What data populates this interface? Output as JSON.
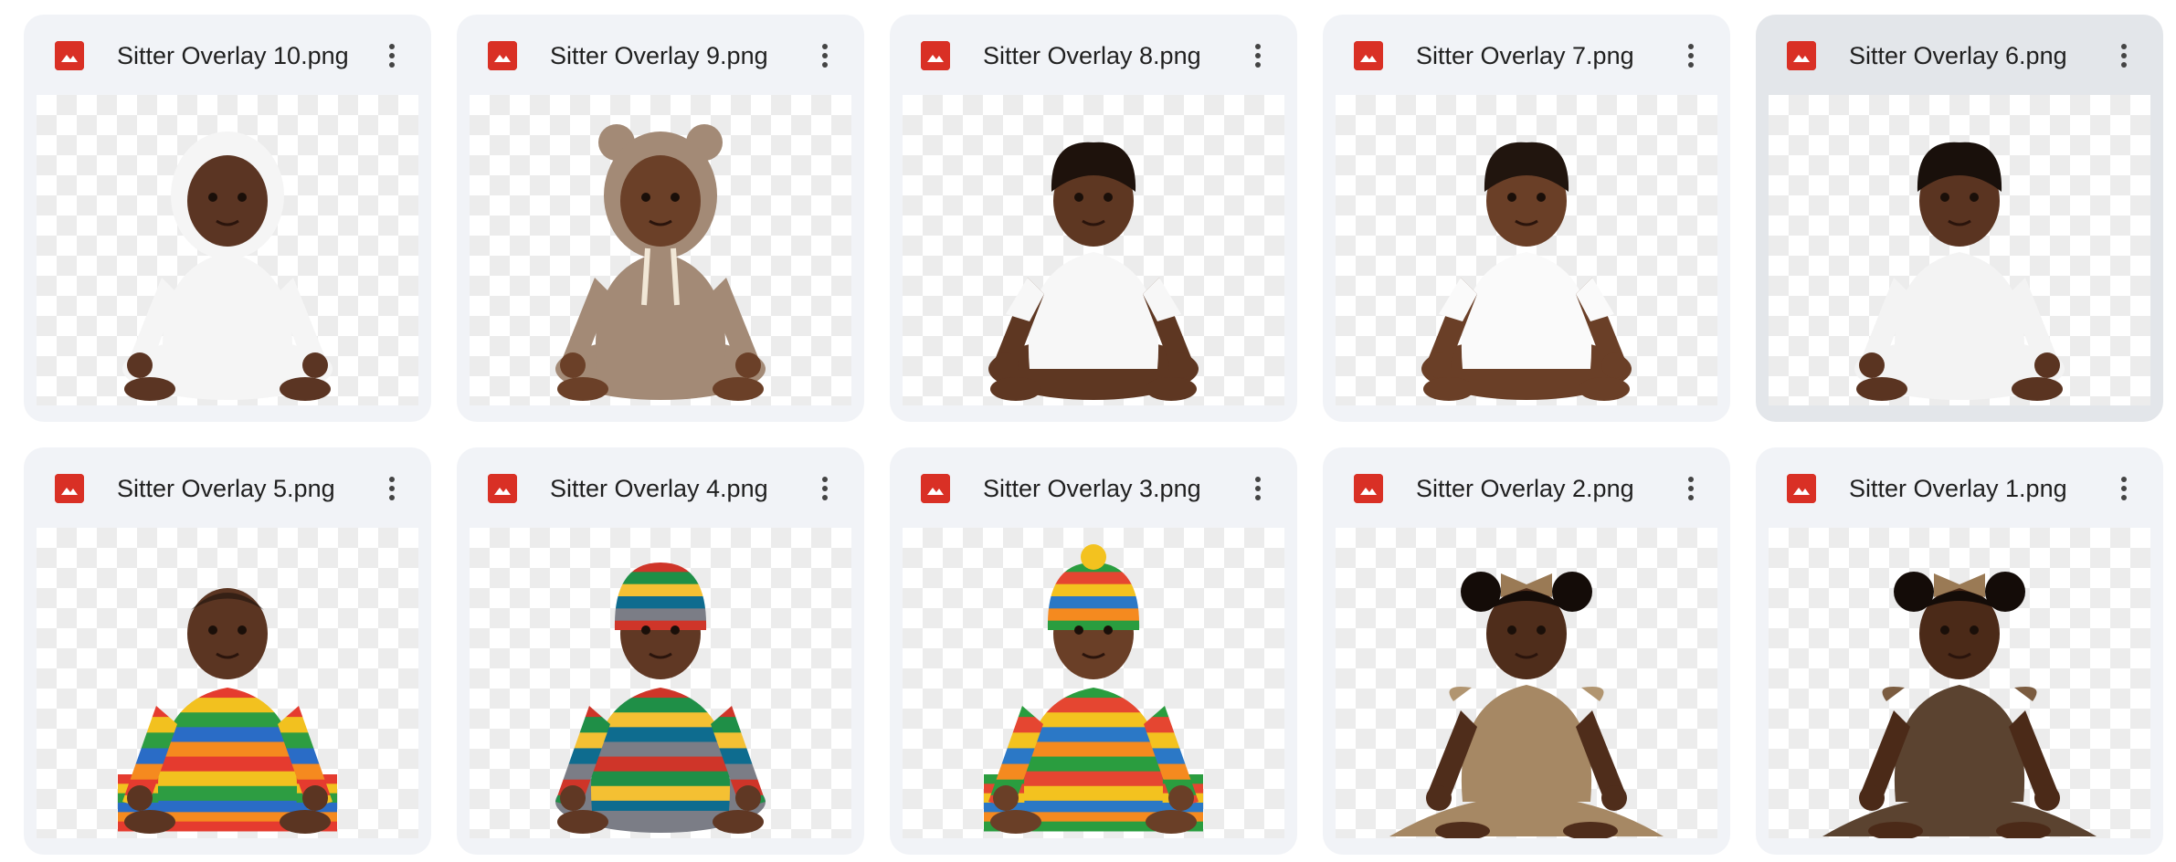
{
  "colors": {
    "card_bg": "#f1f3f7",
    "card_selected_bg": "#e3e6ea",
    "image_icon": "#d93025",
    "text": "#1f1f1f",
    "checker": "#ececec"
  },
  "files": [
    {
      "name": "Sitter Overlay 10.png",
      "icon": "image-file-icon",
      "more_icon": "more-vert-icon",
      "selected": false,
      "thumb": {
        "skin": "#5b3523",
        "outfit": "#f5f5f5",
        "outfit_style": "hooded-onesie",
        "hair": "#2a1a12",
        "accessory": "white-hood",
        "palette": [
          "#f5f5f5"
        ]
      }
    },
    {
      "name": "Sitter Overlay 9.png",
      "icon": "image-file-icon",
      "more_icon": "more-vert-icon",
      "selected": false,
      "thumb": {
        "skin": "#6b4028",
        "outfit": "#a38a76",
        "outfit_style": "bear-hood-knit",
        "hair": "#2a1a12",
        "accessory": "bear-ears-hood",
        "palette": [
          "#a38a76",
          "#f1e7d6"
        ]
      }
    },
    {
      "name": "Sitter Overlay 8.png",
      "icon": "image-file-icon",
      "more_icon": "more-vert-icon",
      "selected": false,
      "thumb": {
        "skin": "#5e3722",
        "outfit": "#f7f7f7",
        "outfit_style": "white-shirt",
        "hair": "#1e120c",
        "accessory": "curly-hair",
        "palette": [
          "#f7f7f7"
        ]
      }
    },
    {
      "name": "Sitter Overlay 7.png",
      "icon": "image-file-icon",
      "more_icon": "more-vert-icon",
      "selected": false,
      "thumb": {
        "skin": "#6a3f27",
        "outfit": "#fafafa",
        "outfit_style": "white-onesie",
        "hair": "#21150e",
        "accessory": "short-hair",
        "palette": [
          "#fafafa"
        ]
      }
    },
    {
      "name": "Sitter Overlay 6.png",
      "icon": "image-file-icon",
      "more_icon": "more-vert-icon",
      "selected": true,
      "thumb": {
        "skin": "#5a3421",
        "outfit": "#f3f3f3",
        "outfit_style": "white-jumpsuit",
        "hair": "#19100b",
        "accessory": "curly-hair",
        "palette": [
          "#f3f3f3"
        ]
      }
    },
    {
      "name": "Sitter Overlay 5.png",
      "icon": "image-file-icon",
      "more_icon": "more-vert-icon",
      "selected": false,
      "thumb": {
        "skin": "#5b3522",
        "outfit": "#e53b2f",
        "outfit_style": "rainbow-knit",
        "hair": "#1d130d",
        "accessory": "bald",
        "palette": [
          "#e53b2f",
          "#f2c11f",
          "#2d9d42",
          "#2a6cc6",
          "#f58a1f"
        ]
      }
    },
    {
      "name": "Sitter Overlay 4.png",
      "icon": "image-file-icon",
      "more_icon": "more-vert-icon",
      "selected": false,
      "thumb": {
        "skin": "#603824",
        "outfit": "#cf3529",
        "outfit_style": "striped-sweater",
        "hair": "#1f140e",
        "accessory": "striped-beanie",
        "palette": [
          "#cf3529",
          "#1f8f47",
          "#f4c033",
          "#0e6c8f",
          "#7b7d86"
        ]
      }
    },
    {
      "name": "Sitter Overlay 3.png",
      "icon": "image-file-icon",
      "more_icon": "more-vert-icon",
      "selected": false,
      "thumb": {
        "skin": "#6a3f27",
        "outfit": "#2a9d3f",
        "outfit_style": "rainbow-cardigan",
        "hair": "#22150e",
        "accessory": "pompom-beanie",
        "palette": [
          "#2a9d3f",
          "#e54631",
          "#f3c21f",
          "#2b78c6",
          "#f58a1f"
        ]
      }
    },
    {
      "name": "Sitter Overlay 2.png",
      "icon": "image-file-icon",
      "more_icon": "more-vert-icon",
      "selected": false,
      "thumb": {
        "skin": "#4f2d1b",
        "outfit": "#a68864",
        "outfit_style": "ruffle-dress",
        "hair": "#140c08",
        "accessory": "bow-headband",
        "palette": [
          "#a68864",
          "#b19570"
        ]
      }
    },
    {
      "name": "Sitter Overlay 1.png",
      "icon": "image-file-icon",
      "more_icon": "more-vert-icon",
      "selected": false,
      "thumb": {
        "skin": "#4b2a18",
        "outfit": "#5b4330",
        "outfit_style": "ruffle-dress",
        "hair": "#140c08",
        "accessory": "bow-headband",
        "palette": [
          "#5b4330",
          "#7b5c40"
        ]
      }
    }
  ]
}
